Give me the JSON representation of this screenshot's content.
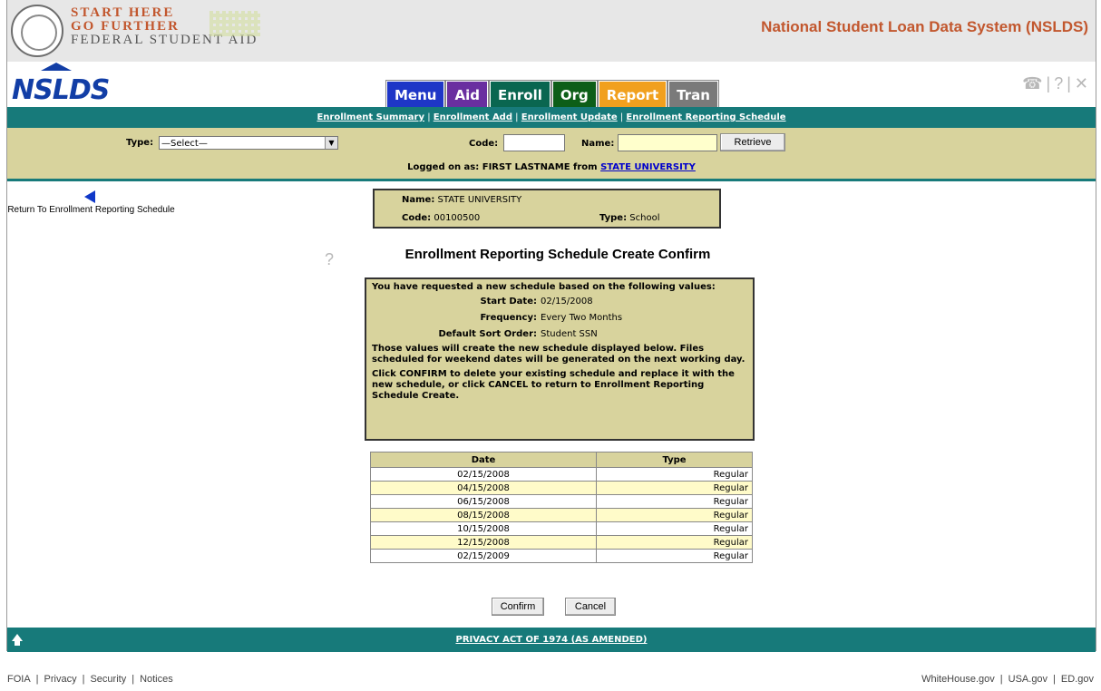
{
  "header": {
    "brand_line1": "START HERE",
    "brand_line2": "GO FURTHER",
    "brand_line3": "FEDERAL STUDENT AID",
    "system_title": "National Student Loan Data System (NSLDS)"
  },
  "nav": {
    "logo": "NSLDS",
    "tabs": [
      "Menu",
      "Aid",
      "Enroll",
      "Org",
      "Report",
      "Tran"
    ],
    "tool_icons": [
      "phone-icon",
      "help-icon",
      "close-icon"
    ]
  },
  "subnav": {
    "links": [
      "Enrollment Summary",
      "Enrollment Add",
      "Enrollment Update",
      "Enrollment Reporting Schedule"
    ]
  },
  "search": {
    "type_label": "Type:",
    "type_value": "—Select—",
    "code_label": "Code:",
    "code_value": "",
    "name_label": "Name:",
    "name_value": "",
    "retrieve_label": "Retrieve",
    "logged_prefix": "Logged on as: FIRST LASTNAME from",
    "logged_org": "STATE UNIVERSITY"
  },
  "back_link": "Return To Enrollment Reporting Schedule",
  "org": {
    "name_label": "Name:",
    "name_value": "STATE UNIVERSITY",
    "code_label": "Code:",
    "code_value": "00100500",
    "type_label": "Type:",
    "type_value": "School"
  },
  "page_title": "Enrollment Reporting Schedule Create Confirm",
  "message": {
    "intro": "You have requested a new schedule based on the following values:",
    "start_label": "Start Date:",
    "start_value": "02/15/2008",
    "freq_label": "Frequency:",
    "freq_value": "Every Two Months",
    "sort_label": "Default Sort Order:",
    "sort_value": "Student SSN",
    "para1": "Those values will create the new schedule displayed below. Files scheduled for weekend dates will be generated on the next working day.",
    "para2": "Click CONFIRM to delete your existing schedule and replace it with the new schedule, or click CANCEL to return to Enrollment Reporting Schedule Create."
  },
  "schedule": {
    "headers": [
      "Date",
      "Type"
    ],
    "rows": [
      [
        "02/15/2008",
        "Regular"
      ],
      [
        "04/15/2008",
        "Regular"
      ],
      [
        "06/15/2008",
        "Regular"
      ],
      [
        "08/15/2008",
        "Regular"
      ],
      [
        "10/15/2008",
        "Regular"
      ],
      [
        "12/15/2008",
        "Regular"
      ],
      [
        "02/15/2009",
        "Regular"
      ]
    ]
  },
  "actions": {
    "confirm": "Confirm",
    "cancel": "Cancel"
  },
  "footer": {
    "privacy": "PRIVACY ACT OF 1974 (AS AMENDED)",
    "left_links": [
      "FOIA",
      "Privacy",
      "Security",
      "Notices"
    ],
    "right_links": [
      "WhiteHouse.gov",
      "USA.gov",
      "ED.gov"
    ]
  }
}
